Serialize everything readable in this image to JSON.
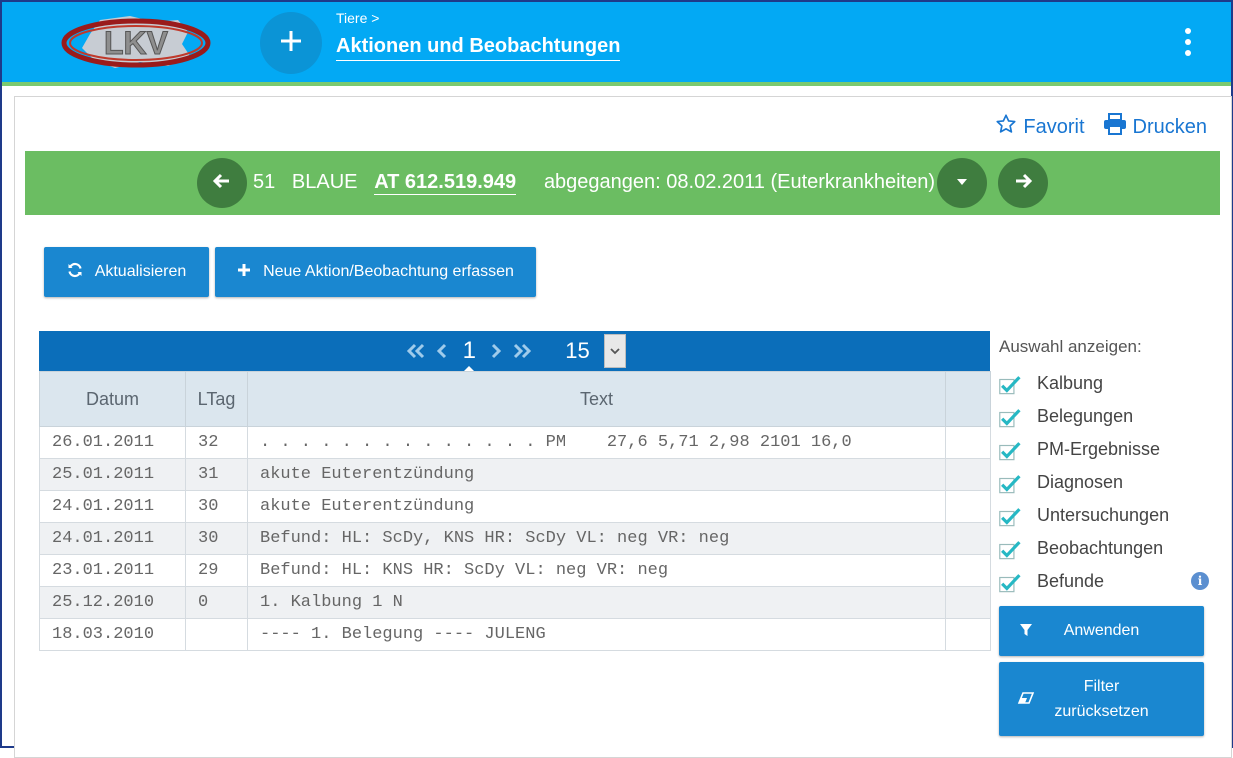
{
  "header": {
    "breadcrumb": "Tiere >",
    "title": "Aktionen und Beobachtungen",
    "logo_text": "LKV",
    "add_icon": "plus-icon",
    "menu_icon": "more-vert-icon"
  },
  "actions": {
    "favorite": "Favorit",
    "print": "Drucken"
  },
  "animal": {
    "number": "51",
    "name": "BLAUE",
    "ear_tag": "AT 612.519.949",
    "status": "abgegangen: 08.02.2011 (Euterkrankheiten)"
  },
  "toolbar": {
    "refresh": "Aktualisieren",
    "new_entry": "Neue Aktion/Beobachtung erfassen"
  },
  "pagination": {
    "current_page": "1",
    "page_size": "15"
  },
  "table": {
    "headers": [
      "Datum",
      "LTag",
      "Text"
    ],
    "rows": [
      [
        "26.01.2011",
        "32",
        ". . . . . . . . . . . . . . PM    27,6 5,71 2,98 2101 16,0"
      ],
      [
        "25.01.2011",
        "31",
        "akute Euterentzündung"
      ],
      [
        "24.01.2011",
        "30",
        "akute Euterentzündung"
      ],
      [
        "24.01.2011",
        "30",
        "Befund: HL: ScDy, KNS HR: ScDy VL: neg VR: neg"
      ],
      [
        "23.01.2011",
        "29",
        "Befund: HL: KNS HR: ScDy VL: neg VR: neg"
      ],
      [
        "25.12.2010",
        "0",
        "1. Kalbung 1 N"
      ],
      [
        "18.03.2010",
        "",
        "---- 1. Belegung ---- JULENG"
      ]
    ]
  },
  "filter": {
    "title": "Auswahl anzeigen:",
    "options": [
      {
        "label": "Kalbung",
        "checked": true
      },
      {
        "label": "Belegungen",
        "checked": true
      },
      {
        "label": "PM-Ergebnisse",
        "checked": true
      },
      {
        "label": "Diagnosen",
        "checked": true
      },
      {
        "label": "Untersuchungen",
        "checked": true
      },
      {
        "label": "Beobachtungen",
        "checked": true
      },
      {
        "label": "Befunde",
        "checked": true
      }
    ],
    "apply": "Anwenden",
    "reset_line1": "Filter",
    "reset_line2": "zurücksetzen"
  },
  "colors": {
    "header": "#03a9f4",
    "animal_bar": "#6bbd62",
    "button": "#1a87d0",
    "pager": "#0b6eba",
    "check": "#26b8c4"
  }
}
